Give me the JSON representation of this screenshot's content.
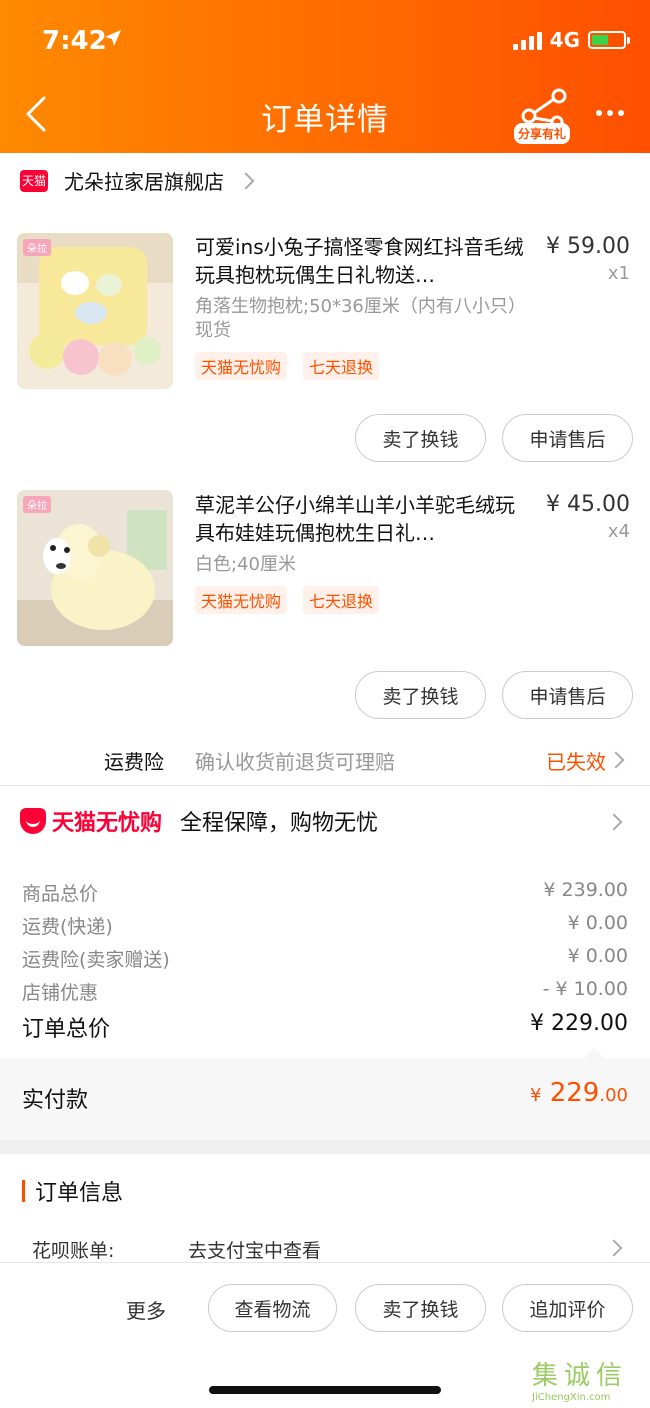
{
  "status_bar": {
    "time": "7:42",
    "network": "4G"
  },
  "header": {
    "title": "订单详情",
    "share_label": "分享有礼"
  },
  "store": {
    "badge": "天猫",
    "name": "尤朵拉家居旗舰店"
  },
  "items": [
    {
      "thumb_ribbon": "朵拉",
      "title": "可爱ins小兔子搞怪零食网红抖音毛绒玩具抱枕玩偶生日礼物送…",
      "price": "¥ 59.00",
      "qty": "x1",
      "spec": "角落生物抱枕;50*36厘米（内有八小只）现货",
      "tags": [
        "天猫无忧购",
        "七天退换"
      ],
      "buttons": [
        "卖了换钱",
        "申请售后"
      ]
    },
    {
      "thumb_ribbon": "朵拉",
      "title": "草泥羊公仔小绵羊山羊小羊驼毛绒玩具布娃娃玩偶抱枕生日礼…",
      "price": "¥ 45.00",
      "qty": "x4",
      "spec": "白色;40厘米",
      "tags": [
        "天猫无忧购",
        "七天退换"
      ],
      "buttons": [
        "卖了换钱",
        "申请售后"
      ]
    }
  ],
  "insurance": {
    "label": "运费险",
    "desc": "确认收货前退货可理赔",
    "status": "已失效"
  },
  "wuyou": {
    "logo": "天猫无忧购",
    "desc": "全程保障，购物无忧"
  },
  "summary": [
    {
      "label": "商品总价",
      "value": "¥ 239.00"
    },
    {
      "label": "运费(快递)",
      "value": "¥ 0.00"
    },
    {
      "label": "运费险(卖家赠送)",
      "value": "¥ 0.00"
    },
    {
      "label": "店铺优惠",
      "value": "- ¥ 10.00"
    }
  ],
  "order_total": {
    "label": "订单总价",
    "value": "¥ 229.00"
  },
  "paid": {
    "label": "实付款",
    "currency": "¥",
    "integer": "229",
    "decimal": ".00"
  },
  "order_info": {
    "title": "订单信息",
    "huabei_label": "花呗账单:",
    "huabei_value": "去支付宝中查看"
  },
  "footer": {
    "more": "更多",
    "buttons": [
      "查看物流",
      "卖了换钱",
      "追加评价"
    ]
  },
  "watermark": {
    "cn": "集诚信",
    "en": "JiChengXin.com"
  },
  "colors": {
    "accent": "#ff5000",
    "header_start": "#ff8a00",
    "header_end": "#ff4f00",
    "tmall_red": "#ff0036"
  }
}
